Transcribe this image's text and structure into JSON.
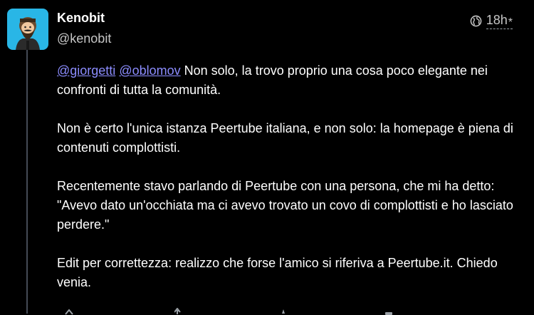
{
  "author": {
    "display_name": "Kenobit",
    "handle": "@kenobit",
    "avatar_icon": "bearded-man-avatar",
    "avatar_bg": "#29b6e6"
  },
  "meta": {
    "visibility_icon": "globe-icon",
    "timestamp": "18h",
    "edited_mark": "*"
  },
  "post": {
    "mentions": [
      "@giorgetti",
      "@oblomov"
    ],
    "p1_text": " Non solo, la trovo proprio una cosa poco elegante nei confronti di tutta la comunità.",
    "p2": "Non è certo l'unica istanza Peertube italiana, e non solo: la homepage è piena di contenuti complottisti.",
    "p3": "Recentemente stavo parlando di Peertube con una persona, che mi ha detto: \"Avevo dato un'occhiata ma ci avevo trovato un covo di complottisti e ho lasciato perdere.\"",
    "p4": "Edit per correttezza: realizzo che forse l'amico si riferiva a Peertube.it. Chiedo venia."
  },
  "actions": [
    {
      "icon": "reply-icon"
    },
    {
      "icon": "boost-icon"
    },
    {
      "icon": "favourite-icon"
    },
    {
      "icon": "more-icon"
    }
  ],
  "colors": {
    "background": "#000000",
    "mention": "#8c8dff",
    "secondary_text": "#c6c6c6",
    "thread_line": "#444a55"
  }
}
